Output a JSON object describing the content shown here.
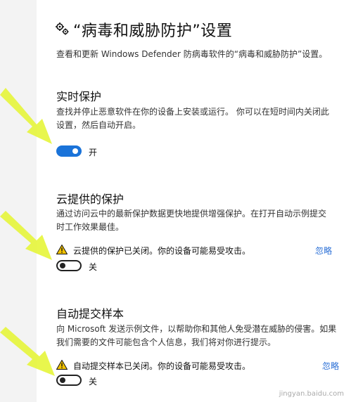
{
  "header": {
    "title": "“病毒和威胁防护”设置",
    "description": "查看和更新 Windows Defender 防病毒软件的“病毒和威胁防护”设置。"
  },
  "sections": [
    {
      "id": "realtime",
      "heading": "实时保护",
      "description_lines": [
        "查找并停止恶意软件在你的设备上安装或运行。 你可以在短时间内关闭此",
        "设置，然后自动开启。"
      ],
      "toggle_on": true,
      "state_label": "开"
    },
    {
      "id": "cloud",
      "heading": "云提供的保护",
      "description_lines": [
        "通过访问云中的最新保护数据更快地提供增强保护。在打开自动示例提交",
        "时工作效果最佳。"
      ],
      "warning": "云提供的保护已关闭。你的设备可能易受攻击。",
      "ignore_label": "忽略",
      "toggle_on": false,
      "state_label": "关"
    },
    {
      "id": "sample",
      "heading": "自动提交样本",
      "description_lines": [
        "向 Microsoft 发送示例文件，以帮助你和其他人免受潜在威胁的侵害。如果",
        "我们需要的文件可能包含个人信息，我们将对你进行提示。"
      ],
      "warning": "自动提交样本已关闭。你的设备可能易受攻击。",
      "ignore_label": "忽略",
      "toggle_on": false,
      "state_label": "关"
    }
  ],
  "colors": {
    "accent": "#1a73d9",
    "link": "#2a6fd6",
    "warning": "#f2c200",
    "arrow": "#e6f53a"
  },
  "watermark": "jingyan.baidu.com"
}
